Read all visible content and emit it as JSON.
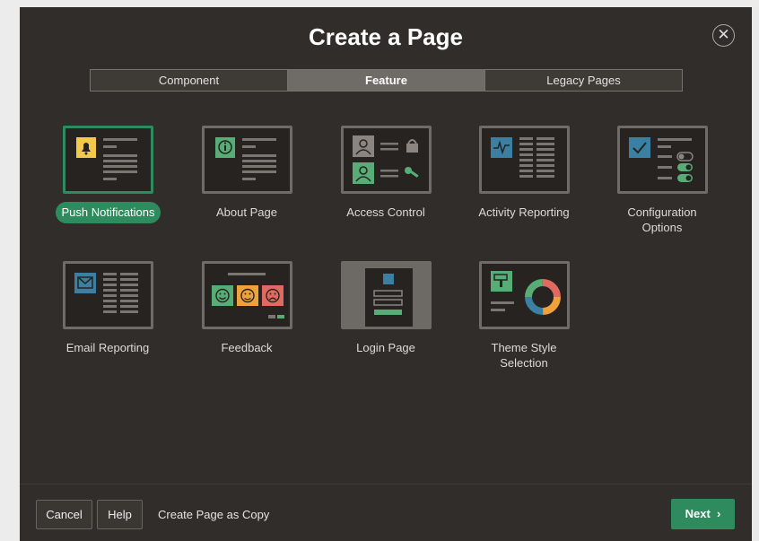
{
  "dialog": {
    "title": "Create a Page",
    "close_icon": "close-icon",
    "tabs": [
      {
        "label": "Component",
        "active": false
      },
      {
        "label": "Feature",
        "active": true
      },
      {
        "label": "Legacy Pages",
        "active": false
      }
    ],
    "features": [
      {
        "label": "Push Notifications",
        "icon": "bell-icon",
        "selected": true
      },
      {
        "label": "About Page",
        "icon": "info-icon",
        "selected": false
      },
      {
        "label": "Access Control",
        "icon": "access-control-icon",
        "selected": false
      },
      {
        "label": "Activity Reporting",
        "icon": "activity-chart-icon",
        "selected": false
      },
      {
        "label": "Configuration\nOptions",
        "icon": "config-toggles-icon",
        "selected": false
      },
      {
        "label": "Email Reporting",
        "icon": "email-icon",
        "selected": false
      },
      {
        "label": "Feedback",
        "icon": "feedback-faces-icon",
        "selected": false
      },
      {
        "label": "Login Page",
        "icon": "login-form-icon",
        "selected": false
      },
      {
        "label": "Theme Style\nSelection",
        "icon": "theme-palette-icon",
        "selected": false
      }
    ],
    "footer": {
      "cancel_label": "Cancel",
      "help_label": "Help",
      "copy_label": "Create Page as Copy",
      "next_label": "Next",
      "next_icon": "chevron-right-icon"
    }
  },
  "colors": {
    "dialog_bg": "#302d2a",
    "accent_green": "#2e8b5d",
    "tab_active": "#6f6b66",
    "icon_yellow": "#f2c94c",
    "icon_green": "#58ad76",
    "icon_blue": "#3b7fa3",
    "icon_red": "#e06a5f",
    "icon_orange": "#f0a23a"
  }
}
